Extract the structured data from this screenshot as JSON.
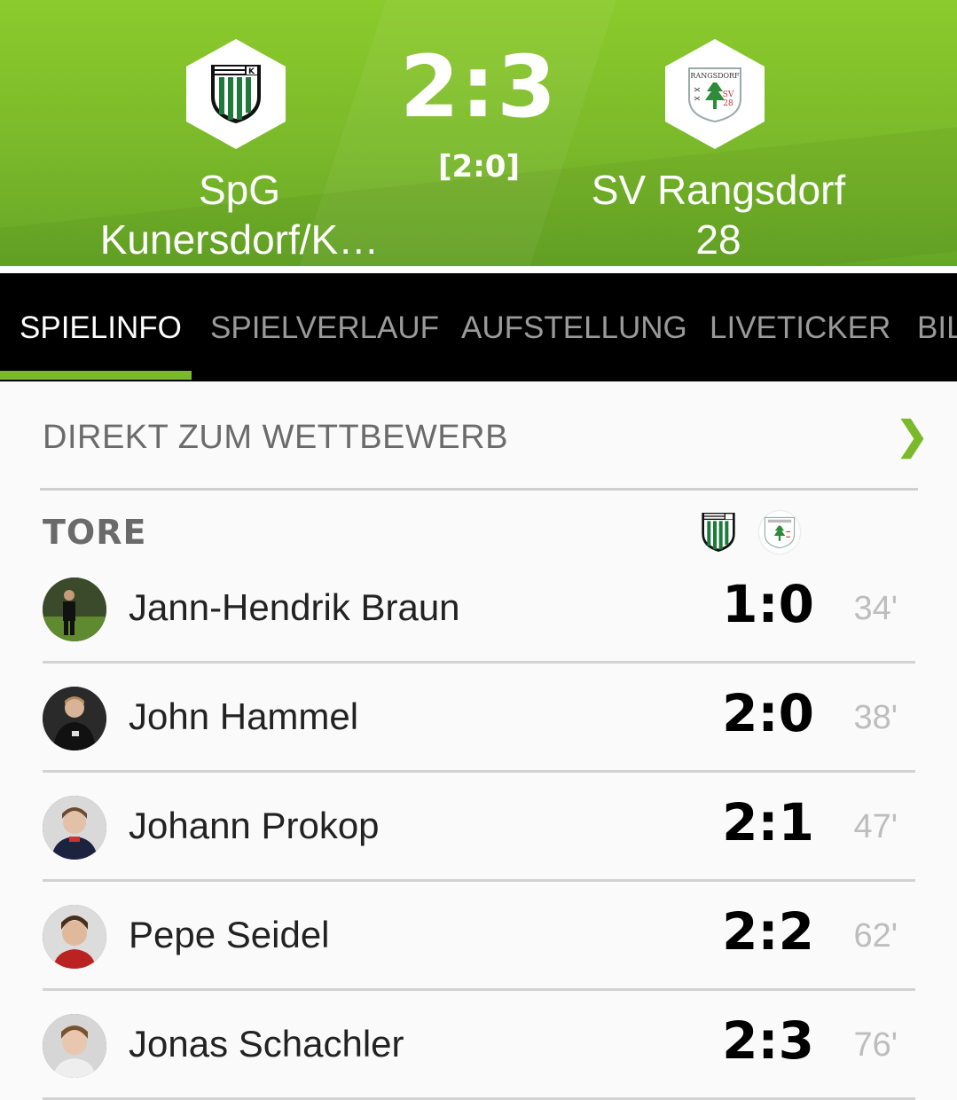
{
  "match": {
    "home_team": "SpG Kunersdorf/K…",
    "home_team_line1": "SpG",
    "home_team_line2": "Kunersdorf/K…",
    "away_team_line1": "SV Rangsdorf",
    "away_team_line2": "28",
    "score": "2:3",
    "halftime": "[2:0]",
    "away_logo_text_1": "RANGSDORF",
    "away_logo_text_2": "SV",
    "away_logo_text_3": "28"
  },
  "tabs": [
    {
      "label": "SPIELINFO",
      "active": true
    },
    {
      "label": "SPIELVERLAUF",
      "active": false
    },
    {
      "label": "AUFSTELLUNG",
      "active": false
    },
    {
      "label": "LIVETICKER",
      "active": false
    },
    {
      "label": "BIL",
      "active": false
    }
  ],
  "competition": {
    "label": "DIREKT ZUM WETTBEWERB",
    "icon": "chevron-right-icon"
  },
  "goals": {
    "title": "TORE",
    "items": [
      {
        "player": "Jann-Hendrik Braun",
        "score": "1:0",
        "minute": "34'"
      },
      {
        "player": "John Hammel",
        "score": "2:0",
        "minute": "38'"
      },
      {
        "player": "Johann Prokop",
        "score": "2:1",
        "minute": "47'"
      },
      {
        "player": "Pepe Seidel",
        "score": "2:2",
        "minute": "62'"
      },
      {
        "player": "Jonas Schachler",
        "score": "2:3",
        "minute": "76'"
      }
    ]
  },
  "colors": {
    "accent": "#7ab92a",
    "header_green": "#8ccb2c",
    "tab_bg": "#000000"
  }
}
